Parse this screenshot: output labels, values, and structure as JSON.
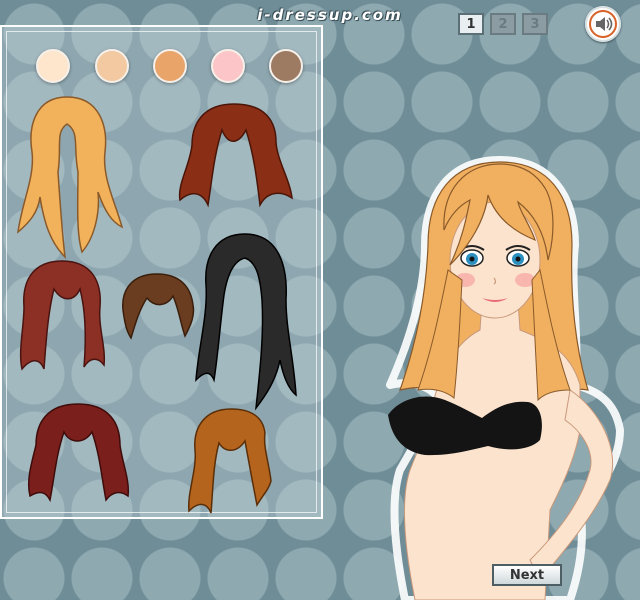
{
  "header": {
    "site_title": "i-dressup.com"
  },
  "page_nav": {
    "pages": [
      "1",
      "2",
      "3"
    ],
    "active": "1"
  },
  "icons": {
    "sound": "speaker-icon"
  },
  "skin_tones": [
    "#fde6cc",
    "#f2c9a0",
    "#e9a46a",
    "#fcc6c8",
    "#9d7b62"
  ],
  "hair_styles": [
    {
      "name": "long-blonde",
      "color": "#f2b25b"
    },
    {
      "name": "auburn-bob",
      "color": "#8a2e16"
    },
    {
      "name": "red-shoulder",
      "color": "#8c2f24"
    },
    {
      "name": "short-brown",
      "color": "#6b3d20"
    },
    {
      "name": "long-black",
      "color": "#2a2a2a"
    },
    {
      "name": "dark-red-curly",
      "color": "#7a1f1c"
    },
    {
      "name": "copper-wavy",
      "color": "#b4641c"
    }
  ],
  "model": {
    "hair_color": "#f0b060",
    "skin": "#fbe3cd",
    "top_color": "#141414",
    "eye_color": "#2b8fc0"
  },
  "footer": {
    "next_label": "Next"
  }
}
